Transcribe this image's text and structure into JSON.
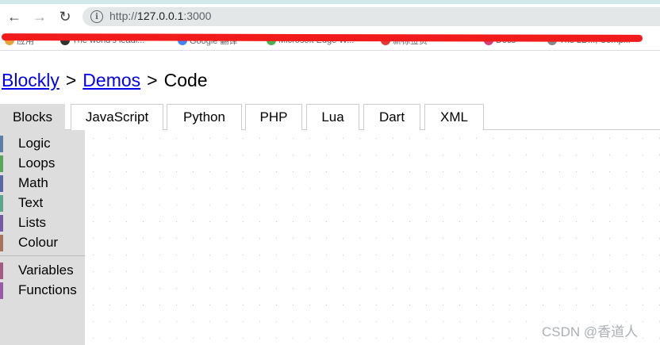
{
  "browser": {
    "url_scheme": "http://",
    "url_host": "127.0.0.1",
    "url_port": ":3000",
    "bookmarks": [
      {
        "label": "应用",
        "color": "#e8a33d"
      },
      {
        "label": "The world's leadi...",
        "color": "#333333"
      },
      {
        "label": "Google 翻译",
        "color": "#4285f4"
      },
      {
        "label": "Microsoft Edge W...",
        "color": "#4caf50"
      },
      {
        "label": "新标签页",
        "color": "#e53935"
      },
      {
        "label": "Docs",
        "color": "#d93b7a"
      },
      {
        "label": "The 2D..., Comp...",
        "color": "#888888"
      }
    ]
  },
  "breadcrumb": {
    "link1": "Blockly",
    "sep1": ">",
    "link2": "Demos",
    "sep2": ">",
    "current": "Code"
  },
  "tabs": [
    {
      "label": "Blocks",
      "active": true
    },
    {
      "label": "JavaScript"
    },
    {
      "label": "Python"
    },
    {
      "label": "PHP"
    },
    {
      "label": "Lua"
    },
    {
      "label": "Dart"
    },
    {
      "label": "XML"
    }
  ],
  "toolbox": [
    {
      "label": "Logic",
      "color": "#5b80a5"
    },
    {
      "label": "Loops",
      "color": "#5ba55b"
    },
    {
      "label": "Math",
      "color": "#5b67a5"
    },
    {
      "label": "Text",
      "color": "#5ba58c"
    },
    {
      "label": "Lists",
      "color": "#745ba5"
    },
    {
      "label": "Colour",
      "color": "#a5745b"
    },
    {
      "label": "Variables",
      "color": "#a55b80"
    },
    {
      "label": "Functions",
      "color": "#995ba5"
    }
  ],
  "watermark": "CSDN @香道人"
}
